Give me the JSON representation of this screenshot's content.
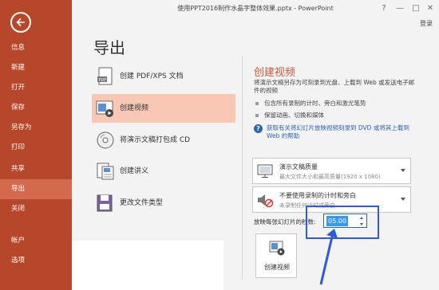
{
  "window": {
    "title": "使用PPT2016制作水晶字整体效果.pptx - PowerPoint",
    "login": "登录",
    "controls": [
      "?",
      "—",
      "□",
      "✕"
    ]
  },
  "sidebar": {
    "back_icon": "back-arrow-icon",
    "items": [
      {
        "label": "信息"
      },
      {
        "label": "新建"
      },
      {
        "label": "打开"
      },
      {
        "label": "保存"
      },
      {
        "label": "另存为"
      },
      {
        "label": "打印"
      },
      {
        "label": "共享"
      },
      {
        "label": "导出",
        "active": true
      },
      {
        "label": "关闭"
      },
      {
        "label": "帐户"
      },
      {
        "label": "选项"
      }
    ]
  },
  "page": {
    "title": "导出"
  },
  "export_options": [
    {
      "label": "创建 PDF/XPS 文档",
      "icon": "pdf-document-icon"
    },
    {
      "label": "创建视频",
      "icon": "video-icon",
      "selected": true
    },
    {
      "label": "将演示文稿打包成 CD",
      "icon": "cd-icon"
    },
    {
      "label": "创建讲义",
      "icon": "handout-icon"
    },
    {
      "label": "更改文件类型",
      "icon": "file-type-icon"
    }
  ],
  "video_panel": {
    "title": "创建视频",
    "description": "将演示文稿另存为可刻录到光盘、上载到 Web 或发送电子邮件的视频",
    "bullets": [
      "包含所有录制的计时、旁白和激光笔势",
      "保留动画、切换和媒体"
    ],
    "help_text": "获取有关将幻灯片放映视频刻录到 DVD 或将其上载到 Web 的帮助",
    "quality": {
      "title": "演示文稿质量",
      "subtitle": "最大文件大小和最高质量(1920 x 1080)"
    },
    "timings": {
      "title": "不要使用录制的计时和旁白",
      "subtitle": "未录制任何计时或旁白"
    },
    "seconds_label": "放映每张幻灯片的秒数:",
    "seconds_value": "05.00",
    "create_button": "创建视频"
  },
  "colors": {
    "accent": "#b7472a",
    "selection": "#f9c8b4",
    "link": "#2b63b5",
    "annotation": "#2f5bd6"
  }
}
